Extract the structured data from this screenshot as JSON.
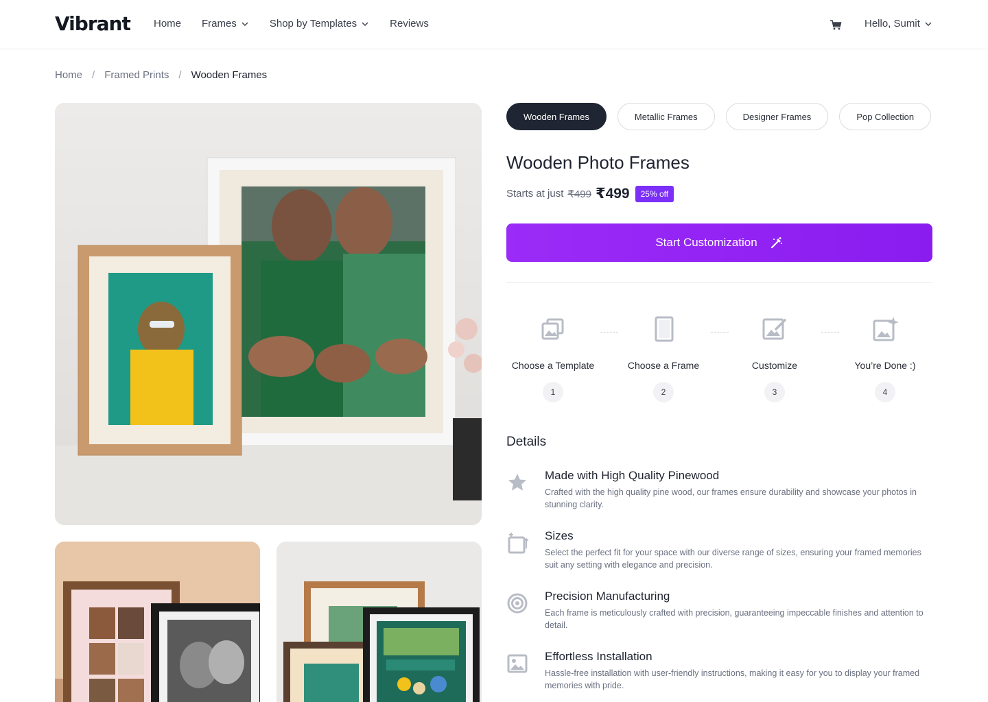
{
  "header": {
    "logo": "Vibrant",
    "nav": [
      {
        "label": "Home"
      },
      {
        "label": "Frames"
      },
      {
        "label": "Shop by Templates"
      },
      {
        "label": "Reviews"
      }
    ],
    "user_label": "Hello, Sumit"
  },
  "breadcrumb": [
    "Home",
    "Framed Prints",
    "Wooden Frames"
  ],
  "categories": [
    "Wooden Frames",
    "Metallic Frames",
    "Designer Frames",
    "Pop Collection"
  ],
  "product": {
    "title": "Wooden Photo Frames",
    "price_lead": "Starts at just",
    "old_price": "₹499",
    "price": "₹499",
    "discount": "25% off",
    "cta_label": "Start Customization"
  },
  "steps": [
    {
      "label": "Choose a Template",
      "number": "1",
      "icon": "gallery-icon"
    },
    {
      "label": "Choose a Frame",
      "number": "2",
      "icon": "frame-icon"
    },
    {
      "label": "Customize",
      "number": "3",
      "icon": "edit-image-icon"
    },
    {
      "label": "You’re Done :)",
      "number": "4",
      "icon": "sparkle-image-icon"
    }
  ],
  "details": {
    "heading": "Details",
    "items": [
      {
        "title": "Made with High Quality Pinewood",
        "desc": "Crafted with the high quality pine wood, our frames ensure durability and showcase your photos in stunning clarity.",
        "icon": "star-icon"
      },
      {
        "title": "Sizes",
        "desc": "Select the perfect fit for your space with our diverse range of sizes, ensuring your framed memories suit any setting with elegance and precision.",
        "icon": "resize-icon"
      },
      {
        "title": "Precision Manufacturing",
        "desc": "Each frame is meticulously crafted with precision, guaranteeing impeccable finishes and attention to detail.",
        "icon": "target-icon"
      },
      {
        "title": "Effortless Installation",
        "desc": "Hassle-free installation with user-friendly instructions, making it easy for you to display your framed memories with pride.",
        "icon": "image-icon"
      }
    ]
  },
  "colors": {
    "accent": "#8a1cf0",
    "chip_active": "#1f2532",
    "badge": "#7b2ff7"
  }
}
